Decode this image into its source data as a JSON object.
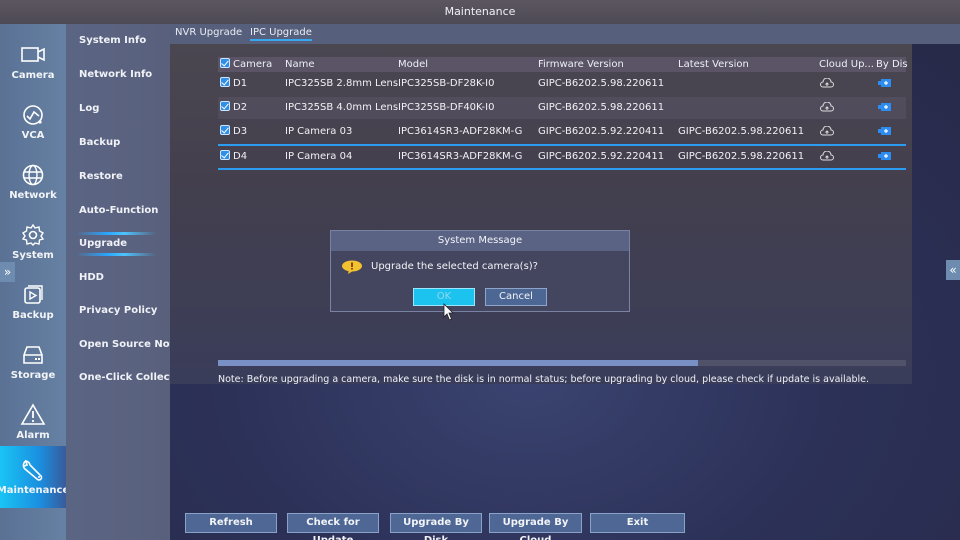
{
  "window": {
    "title": "Maintenance"
  },
  "rail": {
    "items": [
      {
        "label": "Camera",
        "icon": "camera-icon"
      },
      {
        "label": "VCA",
        "icon": "vca-icon"
      },
      {
        "label": "Network",
        "icon": "globe-icon"
      },
      {
        "label": "System",
        "icon": "gear-icon"
      },
      {
        "label": "Backup",
        "icon": "backup-icon"
      },
      {
        "label": "Storage",
        "icon": "storage-icon"
      },
      {
        "label": "Alarm",
        "icon": "warning-icon"
      },
      {
        "label": "Maintenance",
        "icon": "wrench-icon",
        "active": true
      }
    ],
    "expand_glyph": "»"
  },
  "submenu": {
    "items": [
      "System Info",
      "Network Info",
      "Log",
      "Backup",
      "Restore",
      "Auto-Function",
      "Upgrade",
      "HDD",
      "Privacy Policy",
      "Open Source Not...",
      "One-Click Collect"
    ],
    "active": "Upgrade"
  },
  "tabs": [
    {
      "label": "NVR Upgrade",
      "active": false
    },
    {
      "label": "IPC Upgrade",
      "active": true
    }
  ],
  "table": {
    "headers": [
      "Camera",
      "Name",
      "Model",
      "Firmware Version",
      "Latest Version",
      "Cloud Up...",
      "By Dis"
    ],
    "rows": [
      {
        "camera": "D1",
        "checked": true,
        "name": "IPC325SB 2.8mm Lens",
        "model": "IPC325SB-DF28K-I0",
        "firmware": "GIPC-B6202.5.98.220611",
        "latest": "",
        "selected": false
      },
      {
        "camera": "D2",
        "checked": true,
        "name": "IPC325SB 4.0mm Lens",
        "model": "IPC325SB-DF40K-I0",
        "firmware": "GIPC-B6202.5.98.220611",
        "latest": "",
        "selected": false
      },
      {
        "camera": "D3",
        "checked": true,
        "name": "IP Camera 03",
        "model": "IPC3614SR3-ADF28KM-G",
        "firmware": "GIPC-B6202.5.92.220411",
        "latest": "GIPC-B6202.5.98.220611",
        "selected": false
      },
      {
        "camera": "D4",
        "checked": true,
        "name": "IP Camera 04",
        "model": "IPC3614SR3-ADF28KM-G",
        "firmware": "GIPC-B6202.5.92.220411",
        "latest": "GIPC-B6202.5.98.220611",
        "selected": true
      }
    ]
  },
  "note": "Note: Before upgrading a camera, make sure the disk is in normal status; before upgrading by cloud, please check if update is available.",
  "dialog": {
    "title": "System Message",
    "message": "Upgrade the selected camera(s)?",
    "ok": "OK",
    "cancel": "Cancel"
  },
  "buttons": {
    "refresh": "Refresh",
    "check_update": "Check for Update",
    "upgrade_disk": "Upgrade By Disk",
    "upgrade_cloud": "Upgrade By Cloud",
    "exit": "Exit"
  },
  "right_expand_glyph": "«",
  "colors": {
    "accent": "#1cc3ee",
    "selection": "#2c9cf0",
    "button": "#4e6794"
  }
}
